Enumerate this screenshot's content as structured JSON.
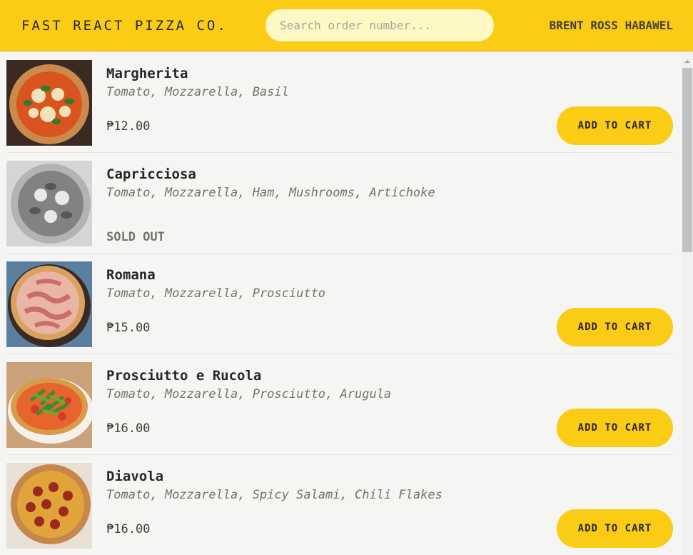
{
  "header": {
    "logo": "Fast React Pizza Co.",
    "search_placeholder": "Search order number...",
    "username": "Brent Ross Habawel"
  },
  "menu": {
    "items": [
      {
        "name": "Margherita",
        "ingredients": "Tomato, Mozzarella, Basil",
        "price": "₱12.00",
        "sold_out": false,
        "button_label": "Add to cart",
        "image_icon": "pizza-margherita-icon"
      },
      {
        "name": "Capricciosa",
        "ingredients": "Tomato, Mozzarella, Ham, Mushrooms, Artichoke",
        "status": "Sold out",
        "sold_out": true,
        "image_icon": "pizza-capricciosa-icon"
      },
      {
        "name": "Romana",
        "ingredients": "Tomato, Mozzarella, Prosciutto",
        "price": "₱15.00",
        "sold_out": false,
        "button_label": "Add to cart",
        "image_icon": "pizza-romana-icon"
      },
      {
        "name": "Prosciutto e Rucola",
        "ingredients": "Tomato, Mozzarella, Prosciutto, Arugula",
        "price": "₱16.00",
        "sold_out": false,
        "button_label": "Add to cart",
        "image_icon": "pizza-prosciutto-rucola-icon"
      },
      {
        "name": "Diavola",
        "ingredients": "Tomato, Mozzarella, Spicy Salami, Chili Flakes",
        "price": "₱16.00",
        "sold_out": false,
        "button_label": "Add to cart",
        "image_icon": "pizza-diavola-icon"
      }
    ]
  },
  "colors": {
    "brand_yellow": "#facc15",
    "search_bg": "#fef9c3",
    "page_bg": "#f5f5f4",
    "text_dark": "#292524",
    "text_muted": "#78716c"
  }
}
